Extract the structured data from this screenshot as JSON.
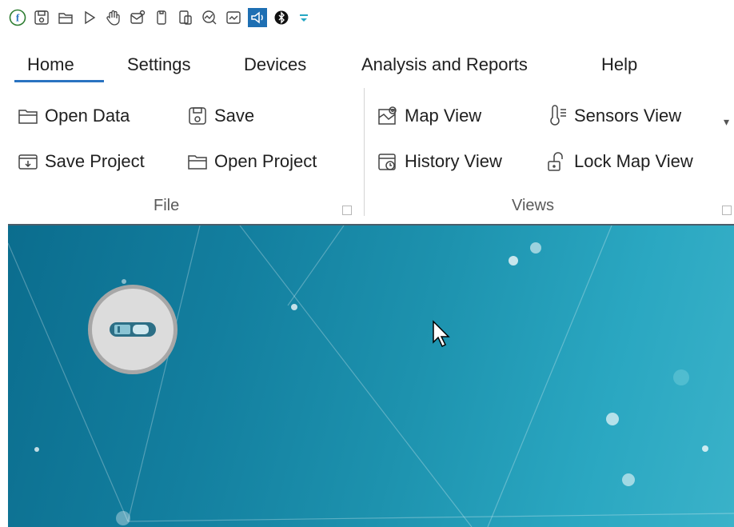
{
  "quick_access": {
    "icons": [
      "app-logo-icon",
      "save-icon",
      "open-icon",
      "play-icon",
      "hand-icon",
      "mail-icon",
      "device-icon",
      "export-icon",
      "analysis-icon",
      "report-icon",
      "volume-icon",
      "bluetooth-icon",
      "customize-icon"
    ]
  },
  "tabs": [
    {
      "label": "Home",
      "active": true
    },
    {
      "label": "Settings"
    },
    {
      "label": "Devices"
    },
    {
      "label": "Analysis and Reports"
    },
    {
      "label": "Help"
    }
  ],
  "ribbon": {
    "file": {
      "open_data": "Open Data",
      "save": "Save",
      "save_project": "Save Project",
      "open_project": "Open Project",
      "label": "File"
    },
    "views": {
      "map_view": "Map View",
      "sensors_view": "Sensors View",
      "history_view": "History View",
      "lock_map_view": "Lock Map View",
      "label": "Views"
    }
  },
  "colors": {
    "accent": "#2a73c1",
    "content_gradient_start": "#0b6d8e",
    "content_gradient_end": "#3ab2c9",
    "device_circle": "#dcdcdc"
  }
}
